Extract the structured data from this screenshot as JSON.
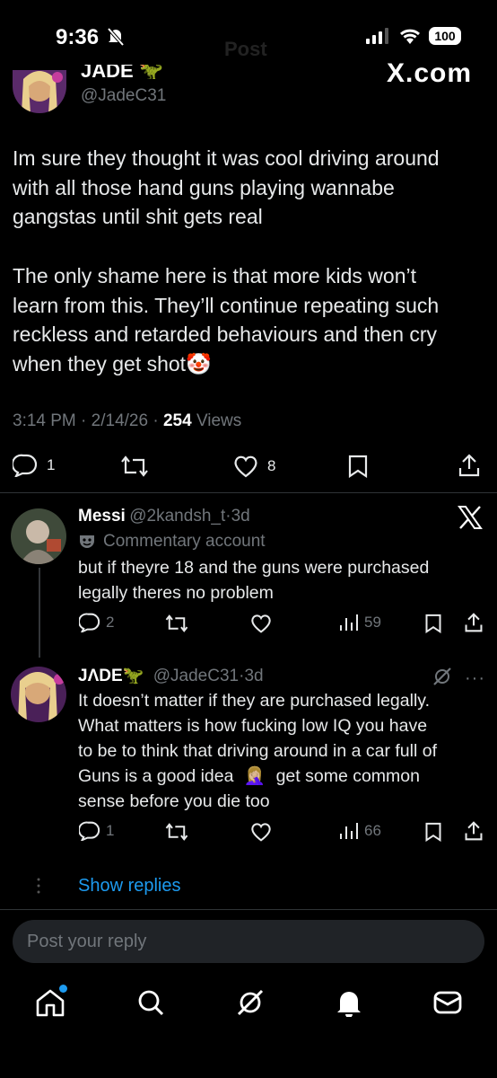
{
  "status_bar": {
    "time": "9:36",
    "battery": "100"
  },
  "header": {
    "ghost_title": "Post",
    "brand": "X.com"
  },
  "tweet": {
    "author_name": "JADE 🦖",
    "author_handle": "@JadeC31",
    "paragraph1": [
      "Im sure they thought it was cool driving around",
      "with all those hand guns playing wannabe",
      "gangstas until shit gets real"
    ],
    "paragraph2": [
      "The only shame here is that more kids won’t",
      "learn from this. They’ll continue repeating such",
      "reckless and retarded behaviours and then cry",
      "when they get shot🤡"
    ],
    "time": "3:14 PM",
    "date": "2/14/26",
    "views_count": "254",
    "views_label": "Views",
    "replies": "1",
    "likes": "8"
  },
  "reply1": {
    "name": "Messi",
    "handle": "@2kandsh_t",
    "age": "3d",
    "badge": "Commentary account",
    "lines": [
      "but if theyre 18 and the guns were purchased",
      "legally theres no problem"
    ],
    "replies": "2",
    "views": "59"
  },
  "reply2": {
    "name": "JΛDE",
    "emoji": "🦖",
    "handle": "@JadeC31",
    "age": "3d",
    "lines": [
      "It doesn’t matter if they are purchased legally.",
      "What matters is how fucking low IQ you have",
      "to be to think that driving around in a car full of",
      "Guns is a good idea",
      "get some common",
      "sense before you die too"
    ],
    "facepalm": "🤦🏼‍♀️",
    "replies": "1",
    "views": "66"
  },
  "show_replies": "Show replies",
  "reply_box": {
    "placeholder": "Post your reply"
  },
  "colors": {
    "accent": "#1d9bf0",
    "background": "#000000",
    "muted": "#71767b"
  },
  "icons": [
    "home-icon",
    "search-icon",
    "grok-icon",
    "notifications-icon",
    "messages-icon"
  ]
}
